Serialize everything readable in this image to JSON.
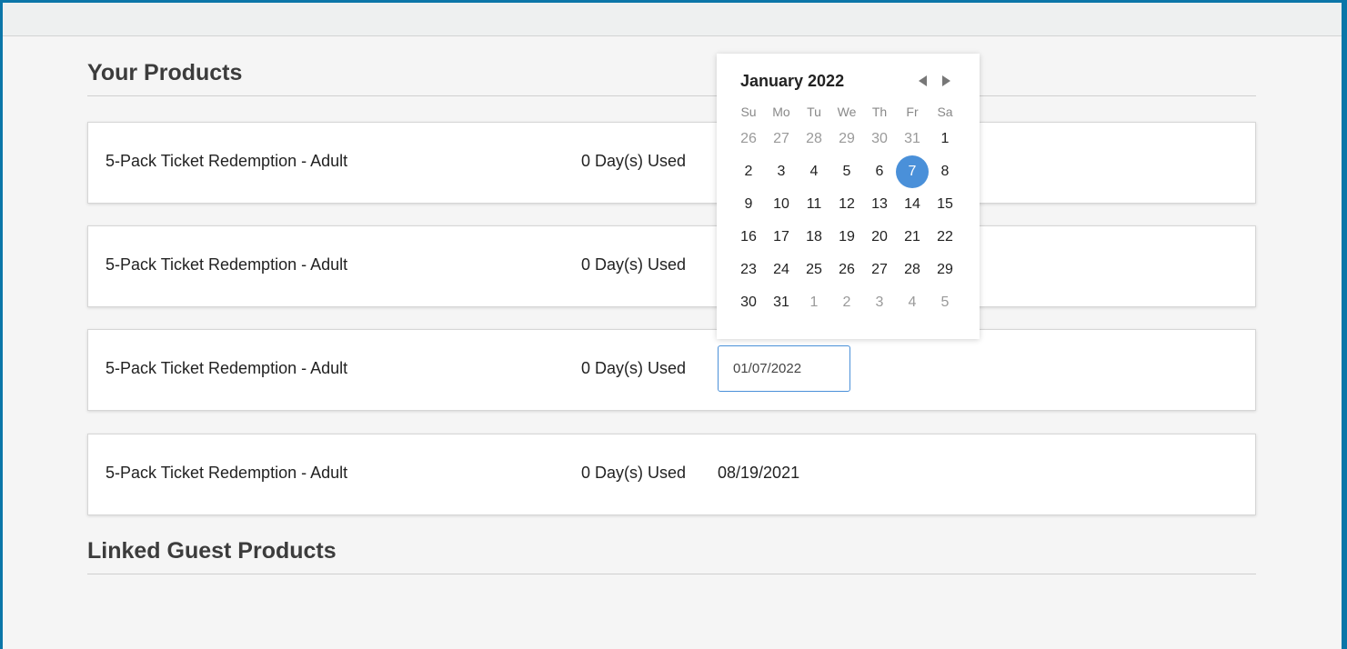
{
  "sections": {
    "your_products": "Your Products",
    "linked_guest_products": "Linked Guest Products"
  },
  "products": [
    {
      "name": "5-Pack Ticket Redemption - Adult",
      "used": "0 Day(s) Used",
      "date": ""
    },
    {
      "name": "5-Pack Ticket Redemption - Adult",
      "used": "0 Day(s) Used",
      "date": ""
    },
    {
      "name": "5-Pack Ticket Redemption - Adult",
      "used": "0 Day(s) Used",
      "date_input_value": "01/07/2022"
    },
    {
      "name": "5-Pack Ticket Redemption - Adult",
      "used": "0 Day(s) Used",
      "date": "08/19/2021"
    }
  ],
  "calendar": {
    "title": "January 2022",
    "weekdays": [
      "Su",
      "Mo",
      "Tu",
      "We",
      "Th",
      "Fr",
      "Sa"
    ],
    "weeks": [
      [
        "26",
        "27",
        "28",
        "29",
        "30",
        "31",
        "1"
      ],
      [
        "2",
        "3",
        "4",
        "5",
        "6",
        "7",
        "8"
      ],
      [
        "9",
        "10",
        "11",
        "12",
        "13",
        "14",
        "15"
      ],
      [
        "16",
        "17",
        "18",
        "19",
        "20",
        "21",
        "22"
      ],
      [
        "23",
        "24",
        "25",
        "26",
        "27",
        "28",
        "29"
      ],
      [
        "30",
        "31",
        "1",
        "2",
        "3",
        "4",
        "5"
      ]
    ],
    "muted": [
      [
        0,
        0
      ],
      [
        0,
        1
      ],
      [
        0,
        2
      ],
      [
        0,
        3
      ],
      [
        0,
        4
      ],
      [
        0,
        5
      ],
      [
        5,
        2
      ],
      [
        5,
        3
      ],
      [
        5,
        4
      ],
      [
        5,
        5
      ],
      [
        5,
        6
      ]
    ],
    "selected": [
      1,
      5
    ],
    "colors": {
      "selected": "#4a90d9",
      "accent": "#0b76a8"
    }
  }
}
